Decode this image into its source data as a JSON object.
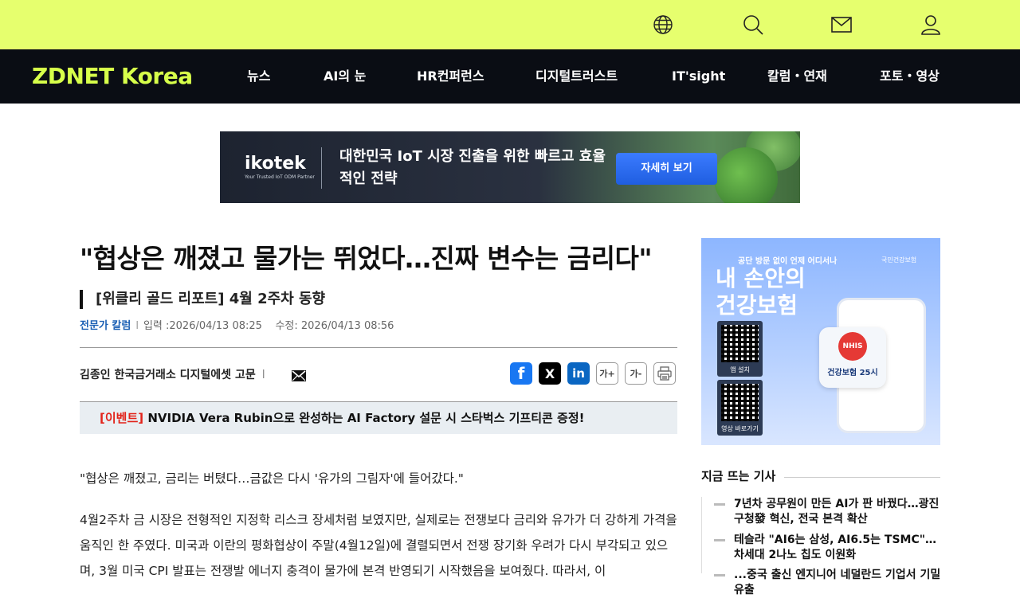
{
  "topbar": {
    "icons": [
      "globe-icon",
      "search-icon",
      "mail-icon",
      "user-icon"
    ],
    "bg_color": "#e6ff6e"
  },
  "navbar": {
    "logo": "ZDNET Korea",
    "items": [
      "뉴스",
      "AI의 눈",
      "HR컨퍼런스",
      "디지털트러스트",
      "IT'sight",
      "칼럼・연재",
      "포토・영상"
    ],
    "bg_color": "#0a0d14",
    "logo_color": "#d7ff4a"
  },
  "ad_banner": {
    "brand": "ikotek",
    "brand_sub": "Your Trusted IoT ODM Partner",
    "headline": "대한민국 IoT 시장 진출을 위한 빠르고 효율적인 전략",
    "cta": "자세히 보기"
  },
  "article": {
    "title": "\"협상은 깨졌고 물가는 뛰었다…진짜 변수는 금리다\"",
    "subtitle": "[위클리 골드 리포트] 4월 2주차 동향",
    "category": "전문가 칼럼",
    "input_date": "입력 :2026/04/13 08:25",
    "modified_date": "수정: 2026/04/13 08:56",
    "author": "김종인 한국금거래소 디지털에셋 고문",
    "share": {
      "facebook": "f",
      "x": "X",
      "linkedin": "in",
      "font_up": "가+",
      "font_down": "가-"
    },
    "event": {
      "tag": "[이벤트]",
      "text": " NVIDIA Vera Rubin으로 완성하는 AI Factory 설문 시 스타벅스 기프티콘 증정!"
    },
    "paragraphs": [
      "\"협상은 깨졌고, 금리는 버텼다…금값은 다시 '유가의 그림자'에 들어갔다.\"",
      "4월2주차 금 시장은 전형적인 지정학 리스크 장세처럼 보였지만, 실제로는 전쟁보다 금리와 유가가 더 강하게 가격을 움직인 한 주였다. 미국과 이란의 평화협상이 주말(4월12일)에 결렬되면서 전쟁 장기화 우려가 다시 부각되고 있으며, 3월 미국 CPI 발표는 전쟁발 에너지 충격이 물가에 본격 반영되기 시작했음을 보여줬다. 따라서, 이"
    ]
  },
  "sidebar": {
    "ad": {
      "top_text": "공단 방문 없이 언제 어디서나",
      "title": "내 손안의 건강보험",
      "org": "국민건강보험",
      "qr1_label": "앱 설치",
      "qr2_label": "영상 바로가기",
      "badge_logo": "NHIS",
      "badge_text": "건강보험 25시"
    },
    "trending_title": "지금 뜨는 기사",
    "trending": [
      "7년차 공무원이 만든 AI가 판 바꿨다…광진구청發 혁신, 전국 본격 확산",
      "테슬라 \"AI6는 삼성, AI6.5는 TSMC\"…차세대 2나노 칩도 이원화",
      "...중국 출신 엔지니어 네덜란드 기업서 기밀 유출"
    ]
  }
}
